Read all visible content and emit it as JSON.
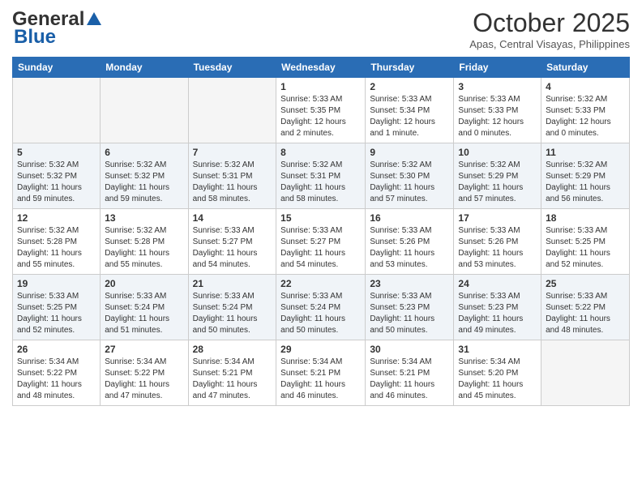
{
  "header": {
    "logo_general": "General",
    "logo_blue": "Blue",
    "month_title": "October 2025",
    "location": "Apas, Central Visayas, Philippines"
  },
  "weekdays": [
    "Sunday",
    "Monday",
    "Tuesday",
    "Wednesday",
    "Thursday",
    "Friday",
    "Saturday"
  ],
  "weeks": [
    [
      {
        "day": "",
        "sunrise": "",
        "sunset": "",
        "daylight": "",
        "empty": true
      },
      {
        "day": "",
        "sunrise": "",
        "sunset": "",
        "daylight": "",
        "empty": true
      },
      {
        "day": "",
        "sunrise": "",
        "sunset": "",
        "daylight": "",
        "empty": true
      },
      {
        "day": "1",
        "sunrise": "Sunrise: 5:33 AM",
        "sunset": "Sunset: 5:35 PM",
        "daylight": "Daylight: 12 hours and 2 minutes.",
        "empty": false
      },
      {
        "day": "2",
        "sunrise": "Sunrise: 5:33 AM",
        "sunset": "Sunset: 5:34 PM",
        "daylight": "Daylight: 12 hours and 1 minute.",
        "empty": false
      },
      {
        "day": "3",
        "sunrise": "Sunrise: 5:33 AM",
        "sunset": "Sunset: 5:33 PM",
        "daylight": "Daylight: 12 hours and 0 minutes.",
        "empty": false
      },
      {
        "day": "4",
        "sunrise": "Sunrise: 5:32 AM",
        "sunset": "Sunset: 5:33 PM",
        "daylight": "Daylight: 12 hours and 0 minutes.",
        "empty": false
      }
    ],
    [
      {
        "day": "5",
        "sunrise": "Sunrise: 5:32 AM",
        "sunset": "Sunset: 5:32 PM",
        "daylight": "Daylight: 11 hours and 59 minutes.",
        "empty": false
      },
      {
        "day": "6",
        "sunrise": "Sunrise: 5:32 AM",
        "sunset": "Sunset: 5:32 PM",
        "daylight": "Daylight: 11 hours and 59 minutes.",
        "empty": false
      },
      {
        "day": "7",
        "sunrise": "Sunrise: 5:32 AM",
        "sunset": "Sunset: 5:31 PM",
        "daylight": "Daylight: 11 hours and 58 minutes.",
        "empty": false
      },
      {
        "day": "8",
        "sunrise": "Sunrise: 5:32 AM",
        "sunset": "Sunset: 5:31 PM",
        "daylight": "Daylight: 11 hours and 58 minutes.",
        "empty": false
      },
      {
        "day": "9",
        "sunrise": "Sunrise: 5:32 AM",
        "sunset": "Sunset: 5:30 PM",
        "daylight": "Daylight: 11 hours and 57 minutes.",
        "empty": false
      },
      {
        "day": "10",
        "sunrise": "Sunrise: 5:32 AM",
        "sunset": "Sunset: 5:29 PM",
        "daylight": "Daylight: 11 hours and 57 minutes.",
        "empty": false
      },
      {
        "day": "11",
        "sunrise": "Sunrise: 5:32 AM",
        "sunset": "Sunset: 5:29 PM",
        "daylight": "Daylight: 11 hours and 56 minutes.",
        "empty": false
      }
    ],
    [
      {
        "day": "12",
        "sunrise": "Sunrise: 5:32 AM",
        "sunset": "Sunset: 5:28 PM",
        "daylight": "Daylight: 11 hours and 55 minutes.",
        "empty": false
      },
      {
        "day": "13",
        "sunrise": "Sunrise: 5:32 AM",
        "sunset": "Sunset: 5:28 PM",
        "daylight": "Daylight: 11 hours and 55 minutes.",
        "empty": false
      },
      {
        "day": "14",
        "sunrise": "Sunrise: 5:33 AM",
        "sunset": "Sunset: 5:27 PM",
        "daylight": "Daylight: 11 hours and 54 minutes.",
        "empty": false
      },
      {
        "day": "15",
        "sunrise": "Sunrise: 5:33 AM",
        "sunset": "Sunset: 5:27 PM",
        "daylight": "Daylight: 11 hours and 54 minutes.",
        "empty": false
      },
      {
        "day": "16",
        "sunrise": "Sunrise: 5:33 AM",
        "sunset": "Sunset: 5:26 PM",
        "daylight": "Daylight: 11 hours and 53 minutes.",
        "empty": false
      },
      {
        "day": "17",
        "sunrise": "Sunrise: 5:33 AM",
        "sunset": "Sunset: 5:26 PM",
        "daylight": "Daylight: 11 hours and 53 minutes.",
        "empty": false
      },
      {
        "day": "18",
        "sunrise": "Sunrise: 5:33 AM",
        "sunset": "Sunset: 5:25 PM",
        "daylight": "Daylight: 11 hours and 52 minutes.",
        "empty": false
      }
    ],
    [
      {
        "day": "19",
        "sunrise": "Sunrise: 5:33 AM",
        "sunset": "Sunset: 5:25 PM",
        "daylight": "Daylight: 11 hours and 52 minutes.",
        "empty": false
      },
      {
        "day": "20",
        "sunrise": "Sunrise: 5:33 AM",
        "sunset": "Sunset: 5:24 PM",
        "daylight": "Daylight: 11 hours and 51 minutes.",
        "empty": false
      },
      {
        "day": "21",
        "sunrise": "Sunrise: 5:33 AM",
        "sunset": "Sunset: 5:24 PM",
        "daylight": "Daylight: 11 hours and 50 minutes.",
        "empty": false
      },
      {
        "day": "22",
        "sunrise": "Sunrise: 5:33 AM",
        "sunset": "Sunset: 5:24 PM",
        "daylight": "Daylight: 11 hours and 50 minutes.",
        "empty": false
      },
      {
        "day": "23",
        "sunrise": "Sunrise: 5:33 AM",
        "sunset": "Sunset: 5:23 PM",
        "daylight": "Daylight: 11 hours and 50 minutes.",
        "empty": false
      },
      {
        "day": "24",
        "sunrise": "Sunrise: 5:33 AM",
        "sunset": "Sunset: 5:23 PM",
        "daylight": "Daylight: 11 hours and 49 minutes.",
        "empty": false
      },
      {
        "day": "25",
        "sunrise": "Sunrise: 5:33 AM",
        "sunset": "Sunset: 5:22 PM",
        "daylight": "Daylight: 11 hours and 48 minutes.",
        "empty": false
      }
    ],
    [
      {
        "day": "26",
        "sunrise": "Sunrise: 5:34 AM",
        "sunset": "Sunset: 5:22 PM",
        "daylight": "Daylight: 11 hours and 48 minutes.",
        "empty": false
      },
      {
        "day": "27",
        "sunrise": "Sunrise: 5:34 AM",
        "sunset": "Sunset: 5:22 PM",
        "daylight": "Daylight: 11 hours and 47 minutes.",
        "empty": false
      },
      {
        "day": "28",
        "sunrise": "Sunrise: 5:34 AM",
        "sunset": "Sunset: 5:21 PM",
        "daylight": "Daylight: 11 hours and 47 minutes.",
        "empty": false
      },
      {
        "day": "29",
        "sunrise": "Sunrise: 5:34 AM",
        "sunset": "Sunset: 5:21 PM",
        "daylight": "Daylight: 11 hours and 46 minutes.",
        "empty": false
      },
      {
        "day": "30",
        "sunrise": "Sunrise: 5:34 AM",
        "sunset": "Sunset: 5:21 PM",
        "daylight": "Daylight: 11 hours and 46 minutes.",
        "empty": false
      },
      {
        "day": "31",
        "sunrise": "Sunrise: 5:34 AM",
        "sunset": "Sunset: 5:20 PM",
        "daylight": "Daylight: 11 hours and 45 minutes.",
        "empty": false
      },
      {
        "day": "",
        "sunrise": "",
        "sunset": "",
        "daylight": "",
        "empty": true
      }
    ]
  ]
}
